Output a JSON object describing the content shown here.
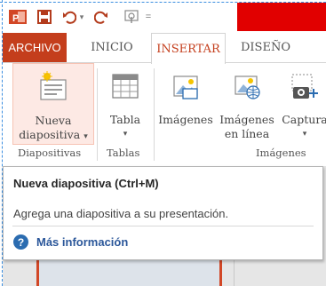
{
  "qat": {
    "app_icon": "powerpoint-icon",
    "save_icon": "save-icon",
    "undo_icon": "undo-icon",
    "undo_caret": "▾",
    "redo_icon": "repeat-icon",
    "touch_icon": "touch-mode-icon",
    "more_caret": "="
  },
  "tabs": [
    {
      "label": "ARCHIVO"
    },
    {
      "label": "INICIO"
    },
    {
      "label": "INSERTAR"
    },
    {
      "label": "DISEÑO"
    }
  ],
  "ribbon": {
    "new_slide": {
      "line1": "Nueva",
      "line2": "diapositiva",
      "caret": "▾",
      "icon": "new-slide-icon"
    },
    "table": {
      "label": "Tabla",
      "caret": "▾",
      "icon": "table-icon"
    },
    "images": {
      "label": "Imágenes",
      "icon": "image-icon"
    },
    "online_images": {
      "line1": "Imágenes",
      "line2": "en línea",
      "icon": "online-image-icon"
    },
    "capture": {
      "label": "Captura",
      "caret": "▾",
      "icon": "screenshot-icon"
    },
    "groups": {
      "slides": "Diapositivas",
      "tables": "Tablas",
      "images": "Imágenes"
    }
  },
  "tooltip": {
    "title": "Nueva diapositiva (Ctrl+M)",
    "description": "Agrega una diapositiva a su presentación.",
    "more_info": "Más información",
    "help_glyph": "?"
  },
  "colors": {
    "accent": "#c43e1c",
    "title_bar": "#e10000",
    "link": "#2b579a",
    "slide_border": "#d24726"
  }
}
